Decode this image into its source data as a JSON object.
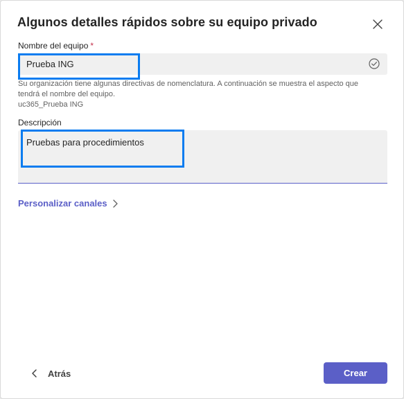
{
  "dialog": {
    "title": "Algunos detalles rápidos sobre su equipo privado",
    "close_icon": "close-icon"
  },
  "team_name": {
    "label": "Nombre del equipo",
    "required_mark": "*",
    "value": "Prueba ING",
    "status_icon": "check-circle-icon",
    "help_line1": "Su organización tiene algunas directivas de nomenclatura. A continuación se muestra el aspecto que",
    "help_line2": "tendrá el nombre del equipo.",
    "preview": "uc365_Prueba ING"
  },
  "description": {
    "label": "Descripción",
    "value": "Pruebas para procedimientos"
  },
  "customize_channels": {
    "label": "Personalizar canales",
    "icon": "chevron-right-icon"
  },
  "footer": {
    "back_label": "Atrás",
    "back_icon": "chevron-left-icon",
    "create_label": "Crear"
  },
  "colors": {
    "accent": "#5b5fc7",
    "highlight": "#0a7cf0",
    "required": "#c4314b"
  }
}
